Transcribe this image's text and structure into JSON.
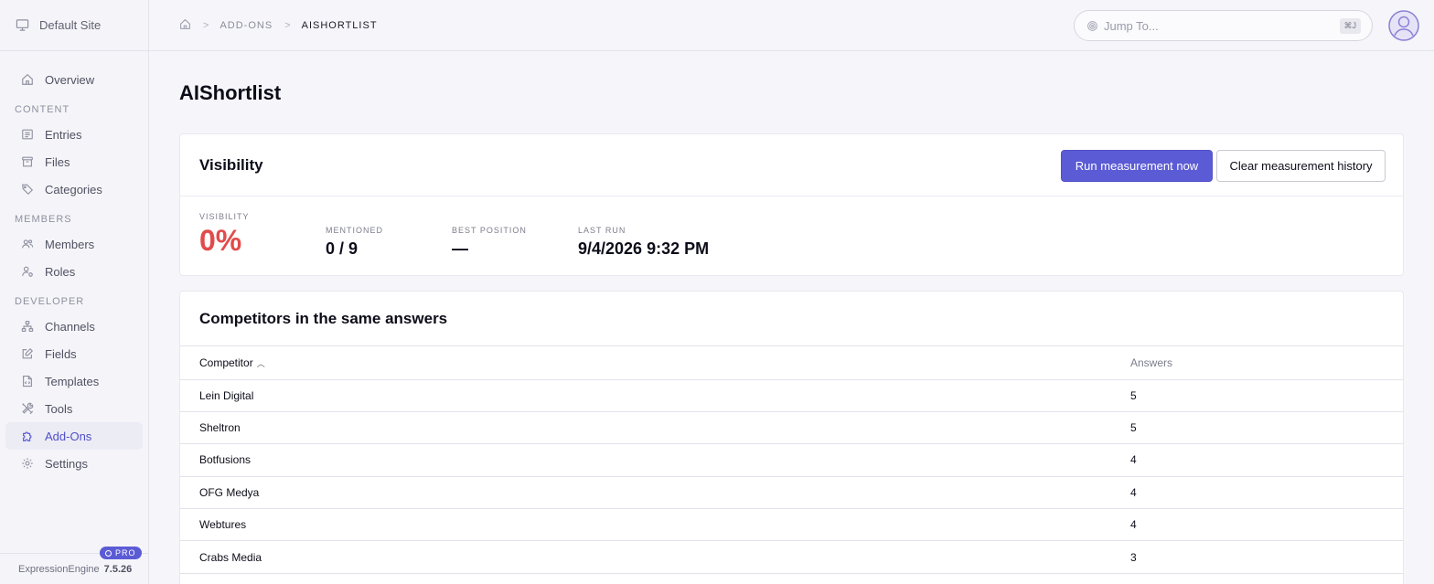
{
  "sidebar": {
    "site_name": "Default Site",
    "overview": "Overview",
    "sections": {
      "content": "CONTENT",
      "members": "MEMBERS",
      "developer": "DEVELOPER"
    },
    "items": {
      "entries": "Entries",
      "files": "Files",
      "categories": "Categories",
      "members": "Members",
      "roles": "Roles",
      "channels": "Channels",
      "fields": "Fields",
      "templates": "Templates",
      "tools": "Tools",
      "addons": "Add-Ons",
      "settings": "Settings"
    },
    "footer": {
      "product": "ExpressionEngine",
      "version": "7.5.26",
      "badge": "PRO"
    }
  },
  "header": {
    "breadcrumb": [
      "ADD-ONS",
      "AISHORTLIST"
    ],
    "separator": ">",
    "jump_placeholder": "Jump To...",
    "jump_shortcut": "⌘J"
  },
  "page": {
    "title": "AIShortlist"
  },
  "visibility": {
    "title": "Visibility",
    "run_button": "Run measurement now",
    "clear_button": "Clear measurement history",
    "stats": {
      "visibility_label": "VISIBILITY",
      "visibility_value": "0%",
      "mentioned_label": "MENTIONED",
      "mentioned_value": "0 / 9",
      "best_label": "BEST POSITION",
      "best_value": "—",
      "last_label": "LAST RUN",
      "last_value": "9/4/2026 9:32 PM"
    }
  },
  "competitors": {
    "title": "Competitors in the same answers",
    "columns": {
      "competitor": "Competitor",
      "answers": "Answers"
    },
    "rows": [
      {
        "name": "Lein Digital",
        "answers": "5"
      },
      {
        "name": "Sheltron",
        "answers": "5"
      },
      {
        "name": "Botfusions",
        "answers": "4"
      },
      {
        "name": "OFG Medya",
        "answers": "4"
      },
      {
        "name": "Webtures",
        "answers": "4"
      },
      {
        "name": "Crabs Media",
        "answers": "3"
      }
    ]
  },
  "colors": {
    "accent": "#5b5bd6",
    "danger": "#e24b4b"
  }
}
